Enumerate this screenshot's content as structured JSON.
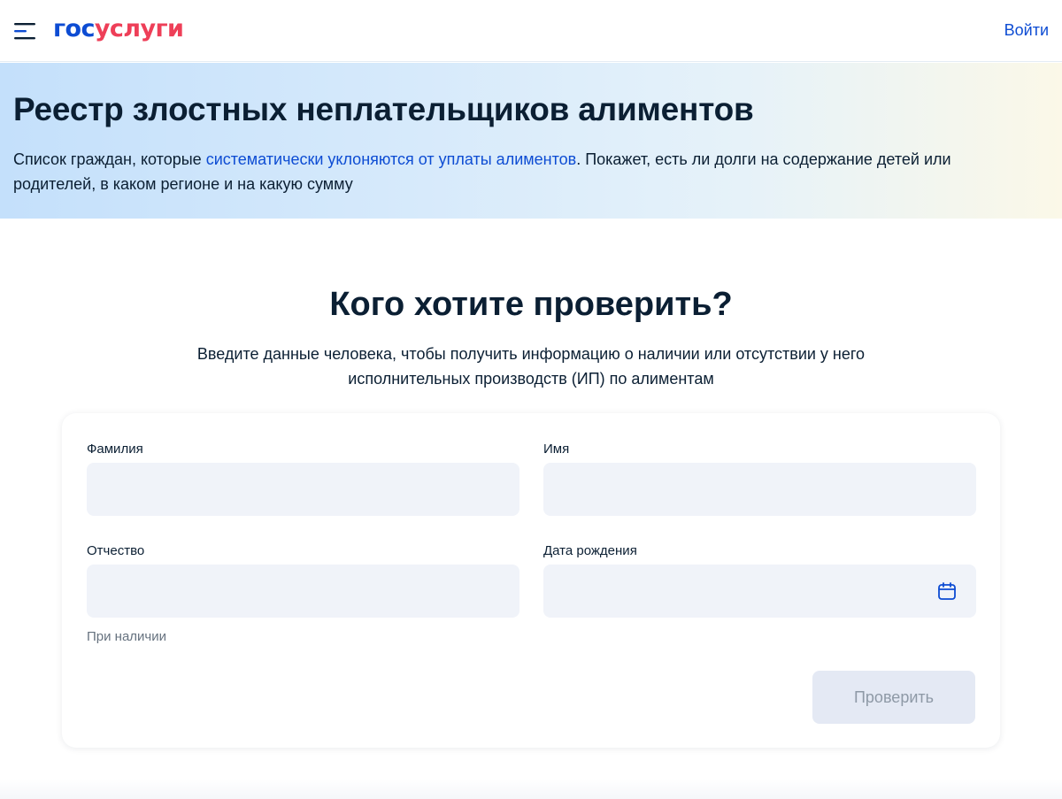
{
  "header": {
    "logo_part1": "гос",
    "logo_part2": "услуги",
    "login_label": "Войти",
    "menu_icon": "hamburger-menu-icon",
    "brand_blue": "#0d4cd3",
    "brand_red": "#ee3f58"
  },
  "hero": {
    "title": "Реестр злостных неплательщиков алиментов",
    "desc_before": "Список граждан, которые ",
    "desc_link": "систематически уклоняются от уплаты алиментов",
    "desc_after": ". Покажет, есть ли долги на содержание детей или родителей, в каком регионе и на какую сумму"
  },
  "section": {
    "title": "Кого хотите проверить?",
    "subtitle": "Введите данные человека, чтобы получить информацию о наличии или отсутствии у него исполнительных производств (ИП) по алиментам"
  },
  "form": {
    "surname_label": "Фамилия",
    "surname_value": "",
    "name_label": "Имя",
    "name_value": "",
    "patronymic_label": "Отчество",
    "patronymic_value": "",
    "patronymic_hint": "При наличии",
    "birthdate_label": "Дата рождения",
    "birthdate_value": "",
    "calendar_icon": "calendar-icon",
    "submit_label": "Проверить"
  }
}
